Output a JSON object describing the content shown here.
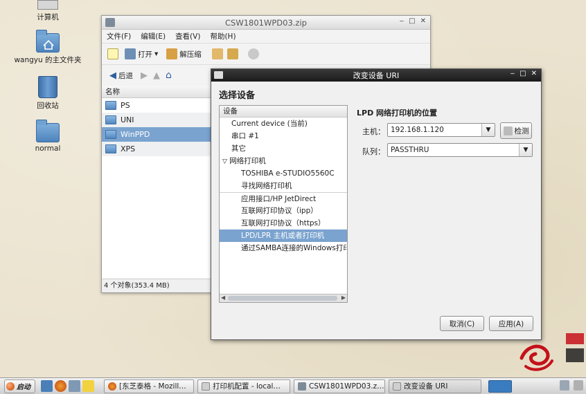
{
  "desktop": {
    "icons": [
      {
        "label": "计算机"
      },
      {
        "label": "wangyu 的主文件夹"
      },
      {
        "label": "回收站"
      },
      {
        "label": "normal"
      }
    ]
  },
  "file_manager": {
    "title": "CSW1801WPD03.zip",
    "menu": [
      "文件(F)",
      "编辑(E)",
      "查看(V)",
      "帮助(H)"
    ],
    "toolbar": {
      "open": "打开",
      "extract": "解压缩"
    },
    "nav": {
      "back": "后退"
    },
    "column_name": "名称",
    "files": [
      {
        "name": "PS",
        "selected": false
      },
      {
        "name": "UNI",
        "selected": false
      },
      {
        "name": "WinPPD",
        "selected": true
      },
      {
        "name": "XPS",
        "selected": false
      }
    ],
    "status": "4 个对象(353.4 MB)"
  },
  "dialog": {
    "title": "改变设备 URI",
    "heading": "选择设备",
    "tree_header": "设备",
    "tree": [
      {
        "label": "Current device (当前)",
        "level": 1
      },
      {
        "label": "串口 #1",
        "level": 1
      },
      {
        "label": "其它",
        "level": 1
      },
      {
        "label": "网络打印机",
        "level": 1,
        "expander": "▽"
      },
      {
        "label": "TOSHIBA e-STUDIO5560C",
        "level": 2
      },
      {
        "label": "寻找网络打印机",
        "level": 2
      },
      {
        "label": "应用接口/HP JetDirect",
        "level": 2,
        "sep": true
      },
      {
        "label": "互联网打印协议（ipp）",
        "level": 2
      },
      {
        "label": "互联网打印协议（https）",
        "level": 2
      },
      {
        "label": "LPD/LPR 主机或者打印机",
        "level": 2,
        "selected": true
      },
      {
        "label": "通过SAMBA连接的Windows打印机",
        "level": 2
      }
    ],
    "lpd_title": "LPD 网络打印机的位置",
    "host_label": "主机：",
    "host_value": "192.168.1.120",
    "probe_button": "检测",
    "queue_label": "队列：",
    "queue_value": "PASSTHRU",
    "cancel_button": "取消(C)",
    "apply_button": "应用(A)"
  },
  "taskbar": {
    "start_label": "启动",
    "tasks": [
      {
        "label": "[东芝泰格 - Mozill…"
      },
      {
        "label": "打印机配置 - local…"
      },
      {
        "label": "CSW1801WPD03.z…"
      },
      {
        "label": "改变设备 URI",
        "active": true
      }
    ]
  },
  "colors": {
    "selection": "#7aa3cf",
    "dialog_titlebar": "#1a1a1a",
    "desktop_bg": "#ebe3cf"
  }
}
